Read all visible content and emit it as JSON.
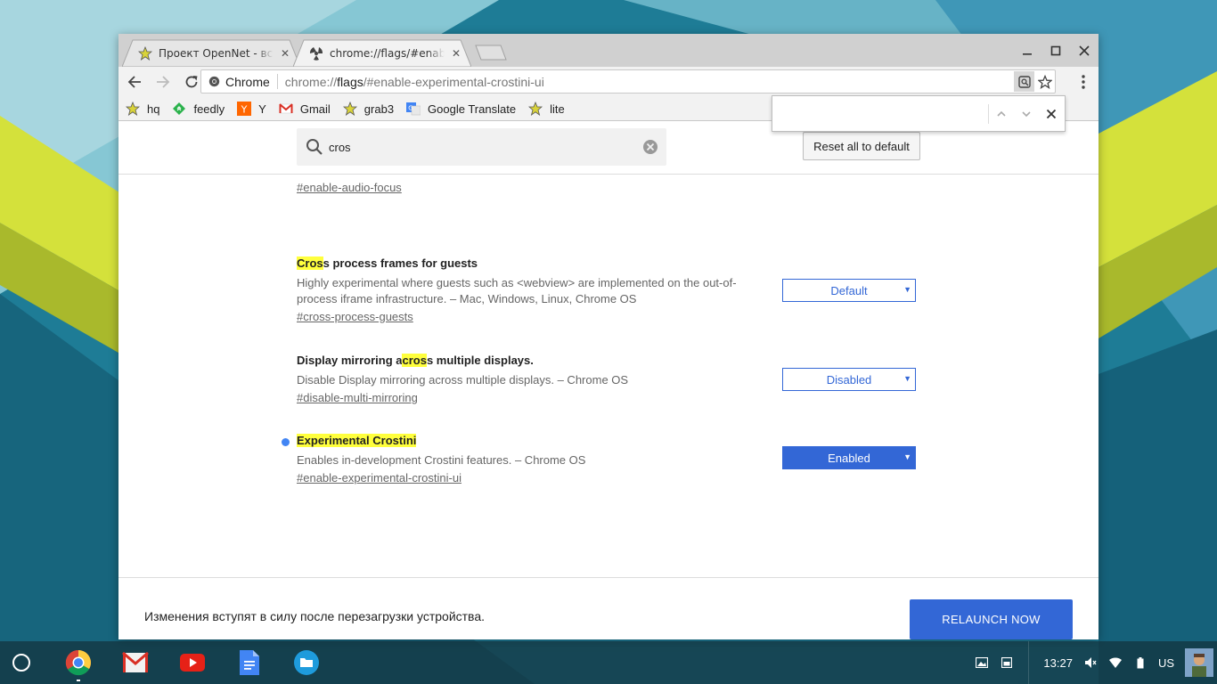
{
  "tabs": [
    {
      "title": "Проект OpenNet - всё, ч",
      "icon": "star-icon",
      "active": false
    },
    {
      "title": "chrome://flags/#enable-e",
      "icon": "flask-icon",
      "active": true
    }
  ],
  "omnibox": {
    "site_label": "Chrome",
    "url_prefix": "chrome://",
    "url_host": "flags",
    "url_rest": "/#enable-experimental-crostini-ui"
  },
  "bookmarks": [
    {
      "label": "hq",
      "icon": "star-icon"
    },
    {
      "label": "feedly",
      "icon": "feedly-icon"
    },
    {
      "label": "Y",
      "icon": "ycombinator-icon"
    },
    {
      "label": "Gmail",
      "icon": "gmail-icon"
    },
    {
      "label": "grab3",
      "icon": "star-icon"
    },
    {
      "label": "Google Translate",
      "icon": "translate-icon"
    },
    {
      "label": "lite",
      "icon": "star-icon"
    }
  ],
  "findbar": {
    "value": ""
  },
  "search": {
    "value": "cros",
    "placeholder": ""
  },
  "reset_label": "Reset all to default",
  "flags": {
    "audio_focus_link": "#enable-audio-focus",
    "cross_process": {
      "title_hl": "Cros",
      "title_rest": "s process frames for guests",
      "desc": "Highly experimental where guests such as <webview> are implemented on the out-of-process iframe infrastructure. – Mac, Windows, Linux, Chrome OS",
      "link": "#cross-process-guests",
      "value": "Default"
    },
    "display_mirroring": {
      "title_pre": "Display mirroring a",
      "title_hl": "cros",
      "title_post": "s multiple displays.",
      "desc": "Disable Display mirroring across multiple displays. – Chrome OS",
      "link": "#disable-multi-mirroring",
      "value": "Disabled"
    },
    "crostini": {
      "title": "Experimental Crostini",
      "desc": "Enables in-development Crostini features. – Chrome OS",
      "link": "#enable-experimental-crostini-ui",
      "value": "Enabled"
    }
  },
  "relaunch": {
    "message": "Изменения вступят в силу после перезагрузки устройства.",
    "button": "RELAUNCH NOW"
  },
  "shelf": {
    "apps": [
      "chrome-icon",
      "gmail-icon",
      "youtube-icon",
      "docs-icon",
      "files-icon"
    ],
    "time": "13:27",
    "lang": "US"
  },
  "colors": {
    "accent": "#3367d6",
    "highlight": "#ffff3d",
    "dot": "#4285f4"
  }
}
